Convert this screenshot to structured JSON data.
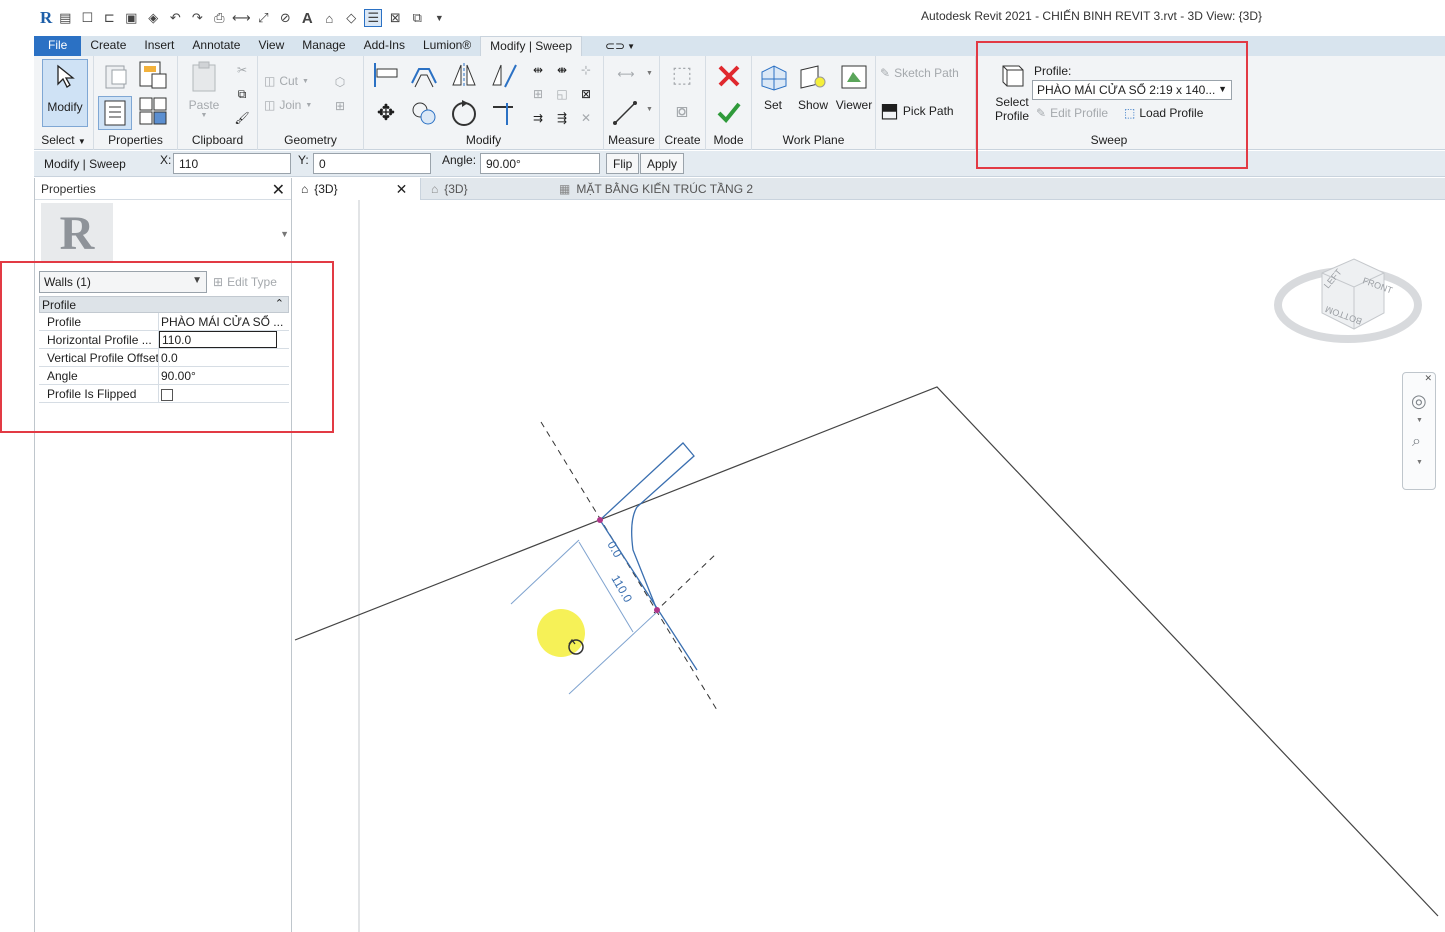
{
  "app": {
    "title": "Autodesk Revit 2021 - CHIẾN BINH REVIT 3.rvt - 3D View: {3D}",
    "logo_letter": "R"
  },
  "ribbon_tabs": [
    {
      "label": "File"
    },
    {
      "label": "Create"
    },
    {
      "label": "Insert"
    },
    {
      "label": "Annotate"
    },
    {
      "label": "View"
    },
    {
      "label": "Manage"
    },
    {
      "label": "Add-Ins"
    },
    {
      "label": "Lumion®"
    },
    {
      "label": "Modify | Sweep"
    }
  ],
  "ribbon": {
    "select": {
      "modify_label": "Modify",
      "panel_label": "Select"
    },
    "properties": {
      "panel_label": "Properties"
    },
    "clipboard": {
      "paste_label": "Paste",
      "panel_label": "Clipboard"
    },
    "geometry": {
      "cut_label": "Cut",
      "join_label": "Join",
      "panel_label": "Geometry"
    },
    "modify": {
      "panel_label": "Modify"
    },
    "measure": {
      "panel_label": "Measure"
    },
    "create": {
      "panel_label": "Create"
    },
    "mode": {
      "panel_label": "Mode"
    },
    "work_plane": {
      "set_label": "Set",
      "show_label": "Show",
      "viewer_label": "Viewer",
      "panel_label": "Work Plane"
    },
    "sweep": {
      "sketch_path_label": "Sketch Path",
      "pick_path_label": "Pick Path",
      "select_profile_label_1": "Select",
      "select_profile_label_2": "Profile",
      "profile_caption": "Profile:",
      "profile_value": "PHÀO MÁI CỬA SỔ 2:19 x 140...",
      "edit_profile_label": "Edit Profile",
      "load_profile_label": "Load Profile",
      "panel_label": "Sweep"
    }
  },
  "options_bar": {
    "context_label": "Modify | Sweep",
    "x_label": "X:",
    "x_value": "110",
    "y_label": "Y:",
    "y_value": "0",
    "angle_label": "Angle:",
    "angle_value": "90.00°",
    "flip_label": "Flip",
    "apply_label": "Apply"
  },
  "properties": {
    "title": "Properties",
    "type_thumb_letter": "R",
    "filter_value": "Walls (1)",
    "edit_type_label": "Edit Type",
    "group_label": "Profile",
    "rows": [
      {
        "name": "Profile",
        "value": "PHÀO MÁI CỬA SỔ ..."
      },
      {
        "name": "Horizontal Profile ...",
        "value": "110.0"
      },
      {
        "name": "Vertical Profile Offset",
        "value": "0.0"
      },
      {
        "name": "Angle",
        "value": "90.00°"
      },
      {
        "name": "Profile Is Flipped",
        "value": ""
      }
    ]
  },
  "view_tabs": [
    {
      "label": "{3D}"
    },
    {
      "label": "{3D}"
    },
    {
      "label": "MẶT BẰNG KIẾN TRÚC TẦNG 2"
    }
  ],
  "canvas": {
    "dim_horizontal": "110.0",
    "dim_vertical": "0.0",
    "viewcube_front": "FRONT",
    "viewcube_left": "LEFT",
    "viewcube_bottom": "BOTTOM"
  },
  "colors": {
    "accent": "#2b71c4",
    "highlight_box": "#e23a44",
    "dimension": "#3a6fb0",
    "cursor_halo": "#f5ef3a"
  }
}
